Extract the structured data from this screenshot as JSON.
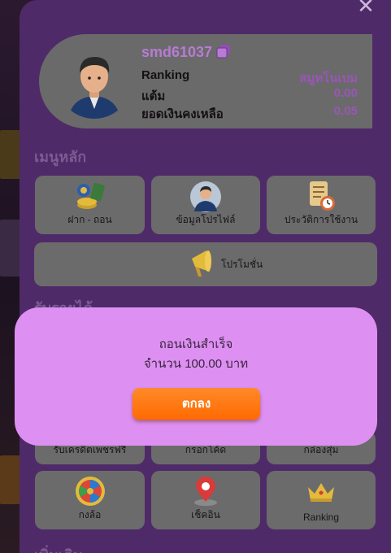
{
  "drawer": {
    "close_glyph": "✕"
  },
  "profile": {
    "username": "smd61037",
    "copy_icon": "copy-icon",
    "rows": [
      {
        "label": "Ranking",
        "value": "สมูทโนเบม"
      },
      {
        "label": "แต้ม",
        "value": "0.00"
      },
      {
        "label": "ยอดเงินคงเหลือ",
        "value": "0.05"
      }
    ]
  },
  "main_menu": {
    "title": "เมนูหลัก",
    "items": [
      {
        "label": "ฝาก - ถอน",
        "icon": "coins-icon"
      },
      {
        "label": "ข้อมูลโปรไฟล์",
        "icon": "profile-icon"
      },
      {
        "label": "ประวัติการใช้งาน",
        "icon": "history-icon"
      }
    ],
    "promo": {
      "label": "โปรโมชั่น",
      "icon": "megaphone-icon"
    }
  },
  "earn_menu": {
    "title": "รับรายได้",
    "items": [
      {
        "label": "รับเครดิตเพชรฟรี"
      },
      {
        "label": "กรอกโค้ด"
      },
      {
        "label": "กล่องสุ่ม"
      },
      {
        "label": "กงล้อ",
        "icon": "wheel-icon"
      },
      {
        "label": "เช็คอิน",
        "icon": "location-pin-icon"
      },
      {
        "label": "Ranking",
        "icon": "crown-icon"
      }
    ]
  },
  "footer_title": "เพิ่มเติม",
  "dialog": {
    "line1": "ถอนเงินสำเร็จ",
    "line2": "จำนวน 100.00 บาท",
    "ok_label": "ตกลง"
  },
  "colors": {
    "drawer_bg": "#4f2a68",
    "dialog_bg": "#dd90f1",
    "ok_button": "#ff7410",
    "accent_text": "#b77bd6"
  }
}
